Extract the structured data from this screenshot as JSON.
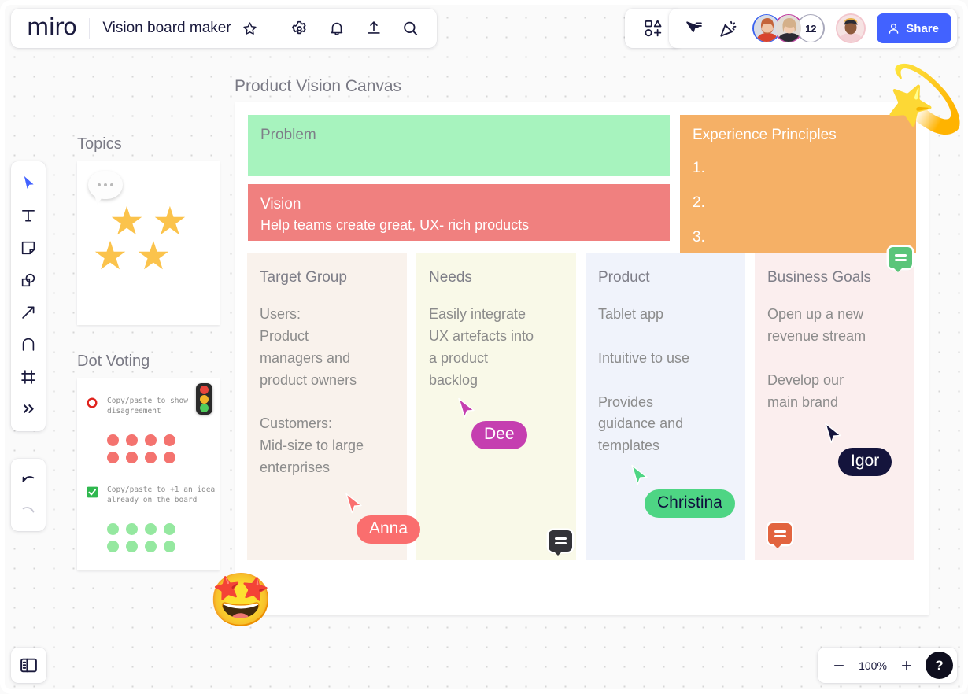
{
  "app": {
    "brand": "miro",
    "board_title": "Vision board maker",
    "zoom_level": "100%",
    "help_label": "?"
  },
  "header": {
    "icons": [
      {
        "name": "star-outline-icon",
        "label": "Favorite board"
      },
      {
        "name": "gear-icon",
        "label": "Board settings"
      },
      {
        "name": "bell-icon",
        "label": "Notifications"
      },
      {
        "name": "upload-icon",
        "label": "Export board"
      },
      {
        "name": "search-icon",
        "label": "Search board"
      }
    ],
    "apps_icon": "apps-grid-add-icon",
    "present_icon": "cursor-present-icon",
    "celebrate_icon": "party-popper-icon",
    "overflow_count": "12",
    "share_label": "Share"
  },
  "toolbar": {
    "tools": [
      {
        "name": "select-tool",
        "label": "Select",
        "active": true
      },
      {
        "name": "text-tool",
        "label": "Text",
        "active": false
      },
      {
        "name": "sticky-note-tool",
        "label": "Sticky note",
        "active": false
      },
      {
        "name": "shapes-tool",
        "label": "Shapes",
        "active": false
      },
      {
        "name": "arrow-tool",
        "label": "Connection line",
        "active": false
      },
      {
        "name": "pen-tool",
        "label": "Pen",
        "active": false
      },
      {
        "name": "frame-tool",
        "label": "Frame",
        "active": false
      },
      {
        "name": "more-tools",
        "label": "More tools",
        "active": false
      }
    ],
    "undo_label": "Undo",
    "redo_label": "Redo"
  },
  "panels": {
    "topics": {
      "label": "Topics",
      "bubble_icon": "speech-bubble-icon",
      "stars": [
        "★",
        "★",
        "★",
        "★"
      ]
    },
    "dot_voting": {
      "label": "Dot Voting",
      "traffic_light_icon": "traffic-light-icon",
      "items": [
        {
          "icon": "red-circle-icon",
          "text": "Copy/paste\nto show\ndisagreement",
          "dot_color": "#f4736f",
          "dot_rows": 2,
          "dots_per_row": 4
        },
        {
          "icon": "green-check-icon",
          "text": "Copy/paste to\n+1 an idea already\non the board",
          "dot_color": "#95e8a0",
          "dot_rows": 2,
          "dots_per_row": 4
        }
      ]
    }
  },
  "canvas": {
    "frame_label": "Product Vision Canvas",
    "blocks": {
      "problem": {
        "title": "Problem",
        "body": "",
        "color": "#a7f3be"
      },
      "vision": {
        "title": "Vision",
        "body": "Help teams create great, UX- rich products",
        "color": "#f0807f"
      },
      "experience_principles": {
        "title": "Experience Principles",
        "items": [
          "1.",
          "2.",
          "3."
        ],
        "color": "#f5b066"
      }
    },
    "columns": [
      {
        "title": "Target Group",
        "body": "Users:\nProduct\nmanagers and\nproduct owners\n\nCustomers:\nMid-size to large\nenterprises",
        "color": "#f9f2ec"
      },
      {
        "title": "Needs",
        "body": "Easily integrate\nUX artefacts into\na product\nbacklog",
        "color": "#f9f9e8"
      },
      {
        "title": "Product",
        "body": "Tablet app\n\nIntuitive to use\n\nProvides\nguidance and\ntemplates",
        "color": "#f0f3fb"
      },
      {
        "title": "Business Goals",
        "body": "Open up a new\nrevenue stream\n\nDevelop our\nmain brand",
        "color": "#fbeeee"
      }
    ],
    "comment_badges": [
      {
        "name": "comment-badge-business-goals",
        "color": "#5bc57a"
      },
      {
        "name": "comment-badge-needs",
        "color": "#333338"
      },
      {
        "name": "comment-badge-goals-bottom",
        "color": "#e2643f"
      }
    ],
    "cursors": [
      {
        "name": "Anna",
        "color": "#fa6e6e",
        "text_color": "#ffffff"
      },
      {
        "name": "Dee",
        "color": "#c53fb0",
        "text_color": "#ffffff"
      },
      {
        "name": "Christina",
        "color": "#4ed584",
        "text_color": "#0f0f3d"
      },
      {
        "name": "Igor",
        "color": "#14143c",
        "text_color": "#ffffff"
      }
    ],
    "stickers": [
      {
        "name": "star-struck-emoji",
        "glyph": "🤩"
      },
      {
        "name": "dizzy-star-emoji",
        "glyph": "💫"
      }
    ]
  },
  "footer": {
    "panel_toggle_icon": "sidebar-panel-icon",
    "zoom_out_label": "−",
    "zoom_in_label": "+"
  }
}
